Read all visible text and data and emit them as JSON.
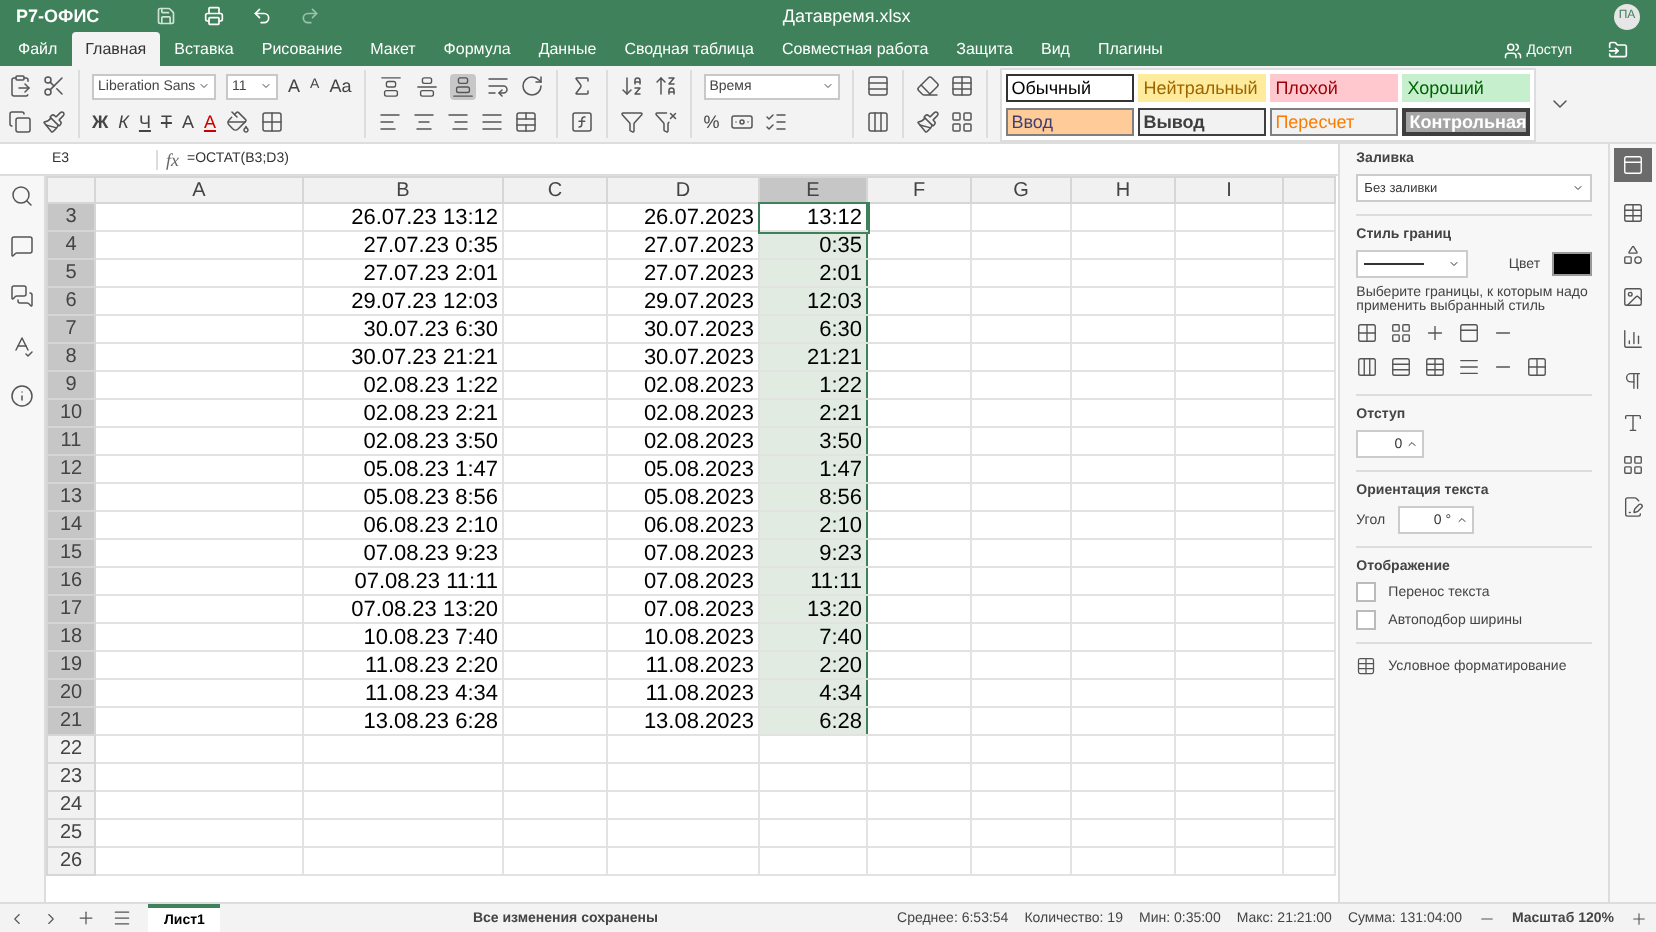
{
  "app": {
    "logo": "Р7-ОФИС",
    "title": "Датавремя.xlsx",
    "avatar": "ПА"
  },
  "menu": [
    {
      "label": "Файл",
      "selected": false
    },
    {
      "label": "Главная",
      "selected": true
    },
    {
      "label": "Вставка",
      "selected": false
    },
    {
      "label": "Рисование",
      "selected": false
    },
    {
      "label": "Макет",
      "selected": false
    },
    {
      "label": "Формула",
      "selected": false
    },
    {
      "label": "Данные",
      "selected": false
    },
    {
      "label": "Сводная таблица",
      "selected": false
    },
    {
      "label": "Совместная работа",
      "selected": false
    },
    {
      "label": "Защита",
      "selected": false
    },
    {
      "label": "Вид",
      "selected": false
    },
    {
      "label": "Плагины",
      "selected": false
    }
  ],
  "share": "Доступ",
  "toolbar": {
    "font": "Liberation Sans",
    "size": "11",
    "grow": "A",
    "shrink": "A",
    "case": "Aa",
    "bold": "Ж",
    "italic": "К",
    "underline": "Ч",
    "strike": "Т",
    "subscript": "A",
    "font_color": "A",
    "vertical_align": [
      {
        "selected": false
      },
      {
        "selected": false
      },
      {
        "selected": true
      }
    ],
    "number_format": "Время",
    "percent": "%"
  },
  "cell_styles": [
    {
      "label": "Обычный",
      "kind": "normal"
    },
    {
      "label": "Нейтральный",
      "kind": "neutral"
    },
    {
      "label": "Плохой",
      "kind": "bad"
    },
    {
      "label": "Хороший",
      "kind": "good"
    },
    {
      "label": "Ввод",
      "kind": "input"
    },
    {
      "label": "Вывод",
      "kind": "output"
    },
    {
      "label": "Пересчет",
      "kind": "calculation"
    },
    {
      "label": "Контрольная",
      "kind": "check"
    }
  ],
  "formula_bar": {
    "cell_ref": "E3",
    "fx": "fx",
    "formula": "=ОСТАТ(B3;D3)"
  },
  "columns": [
    {
      "letter": "A",
      "selected": false
    },
    {
      "letter": "B",
      "selected": false
    },
    {
      "letter": "C",
      "selected": false
    },
    {
      "letter": "D",
      "selected": false
    },
    {
      "letter": "E",
      "selected": true
    },
    {
      "letter": "F",
      "selected": false
    },
    {
      "letter": "G",
      "selected": false
    },
    {
      "letter": "H",
      "selected": false
    },
    {
      "letter": "I",
      "selected": false
    }
  ],
  "rows": [
    {
      "number": "3",
      "selected": true,
      "cells": {
        "B": "26.07.23 13:12",
        "D": "26.07.2023",
        "E": "13:12"
      }
    },
    {
      "number": "4",
      "selected": true,
      "cells": {
        "B": "27.07.23 0:35",
        "D": "27.07.2023",
        "E": "0:35"
      }
    },
    {
      "number": "5",
      "selected": true,
      "cells": {
        "B": "27.07.23 2:01",
        "D": "27.07.2023",
        "E": "2:01"
      }
    },
    {
      "number": "6",
      "selected": true,
      "cells": {
        "B": "29.07.23 12:03",
        "D": "29.07.2023",
        "E": "12:03"
      }
    },
    {
      "number": "7",
      "selected": true,
      "cells": {
        "B": "30.07.23 6:30",
        "D": "30.07.2023",
        "E": "6:30"
      }
    },
    {
      "number": "8",
      "selected": true,
      "cells": {
        "B": "30.07.23 21:21",
        "D": "30.07.2023",
        "E": "21:21"
      }
    },
    {
      "number": "9",
      "selected": true,
      "cells": {
        "B": "02.08.23 1:22",
        "D": "02.08.2023",
        "E": "1:22"
      }
    },
    {
      "number": "10",
      "selected": true,
      "cells": {
        "B": "02.08.23 2:21",
        "D": "02.08.2023",
        "E": "2:21"
      }
    },
    {
      "number": "11",
      "selected": true,
      "cells": {
        "B": "02.08.23 3:50",
        "D": "02.08.2023",
        "E": "3:50"
      }
    },
    {
      "number": "12",
      "selected": true,
      "cells": {
        "B": "05.08.23 1:47",
        "D": "05.08.2023",
        "E": "1:47"
      }
    },
    {
      "number": "13",
      "selected": true,
      "cells": {
        "B": "05.08.23 8:56",
        "D": "05.08.2023",
        "E": "8:56"
      }
    },
    {
      "number": "14",
      "selected": true,
      "cells": {
        "B": "06.08.23 2:10",
        "D": "06.08.2023",
        "E": "2:10"
      }
    },
    {
      "number": "15",
      "selected": true,
      "cells": {
        "B": "07.08.23 9:23",
        "D": "07.08.2023",
        "E": "9:23"
      }
    },
    {
      "number": "16",
      "selected": true,
      "cells": {
        "B": "07.08.23 11:11",
        "D": "07.08.2023",
        "E": "11:11"
      }
    },
    {
      "number": "17",
      "selected": true,
      "cells": {
        "B": "07.08.23 13:20",
        "D": "07.08.2023",
        "E": "13:20"
      }
    },
    {
      "number": "18",
      "selected": true,
      "cells": {
        "B": "10.08.23 7:40",
        "D": "10.08.2023",
        "E": "7:40"
      }
    },
    {
      "number": "19",
      "selected": true,
      "cells": {
        "B": "11.08.23 2:20",
        "D": "11.08.2023",
        "E": "2:20"
      }
    },
    {
      "number": "20",
      "selected": true,
      "cells": {
        "B": "11.08.23 4:34",
        "D": "11.08.2023",
        "E": "4:34"
      }
    },
    {
      "number": "21",
      "selected": true,
      "cells": {
        "B": "13.08.23 6:28",
        "D": "13.08.2023",
        "E": "6:28"
      }
    },
    {
      "number": "22",
      "selected": false,
      "cells": {}
    },
    {
      "number": "23",
      "selected": false,
      "cells": {}
    },
    {
      "number": "24",
      "selected": false,
      "cells": {}
    },
    {
      "number": "25",
      "selected": false,
      "cells": {}
    },
    {
      "number": "26",
      "selected": false,
      "cells": {}
    }
  ],
  "panel": {
    "fill_title": "Заливка",
    "fill_value": "Без заливки",
    "border_title": "Стиль границ",
    "color_label": "Цвет",
    "border_hint": "Выберите границы, к которым надо применить выбранный стиль",
    "indent_title": "Отступ",
    "indent_value": "0",
    "orientation_title": "Ориентация текста",
    "angle_label": "Угол",
    "angle_value": "0 °",
    "display_title": "Отображение",
    "options": [
      {
        "label": "Перенос текста",
        "checked": false
      },
      {
        "label": "Автоподбор ширины",
        "checked": false
      }
    ],
    "conditional": "Условное форматирование"
  },
  "status": {
    "sheets": [
      {
        "label": "Лист1",
        "selected": true
      }
    ],
    "saved": "Все изменения сохранены",
    "stats": [
      "Среднее: 6:53:54",
      "Количество: 19",
      "Мин: 0:35:00",
      "Макс: 21:21:00",
      "Сумма: 131:04:00"
    ],
    "zoom": "Масштаб 120%"
  }
}
